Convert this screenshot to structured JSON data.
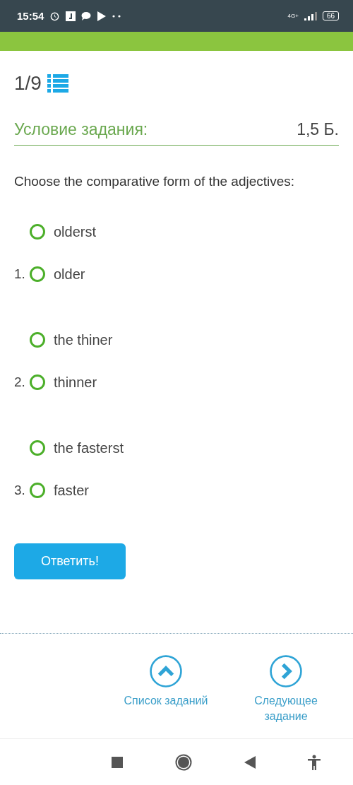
{
  "status_bar": {
    "time": "15:54",
    "network": "4G+",
    "battery": "66"
  },
  "counter": "1/9",
  "task": {
    "title": "Условие задания:",
    "points": "1,5 Б."
  },
  "question": "Choose the comparative form of the adjectives:",
  "groups": [
    {
      "options": [
        {
          "label": "olderst",
          "selected": false
        },
        {
          "number": "1.",
          "label": "older",
          "selected": false
        }
      ]
    },
    {
      "options": [
        {
          "label": "the thiner",
          "selected": false
        },
        {
          "number": "2.",
          "label": "thinner",
          "selected": false
        }
      ]
    },
    {
      "options": [
        {
          "label": "the fasterst",
          "selected": false
        },
        {
          "number": "3.",
          "label": "faster",
          "selected": false
        }
      ]
    }
  ],
  "submit_button": "Ответить!",
  "nav": [
    {
      "kind": "up",
      "label": "Список заданий"
    },
    {
      "kind": "next",
      "label": "Следующее задание"
    }
  ]
}
